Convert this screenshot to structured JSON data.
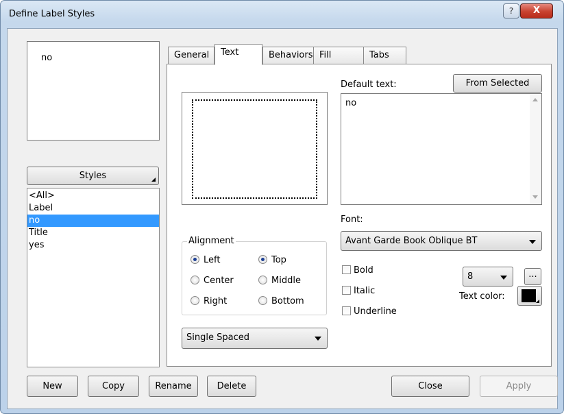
{
  "window": {
    "title": "Define Label Styles",
    "help_label": "?",
    "close_label": "X"
  },
  "preview": {
    "text": "no"
  },
  "styles": {
    "button_label": "Styles",
    "items": [
      "<All>",
      "Label",
      "no",
      "Title",
      "yes"
    ],
    "selected": "no"
  },
  "tabs": [
    {
      "label": "General",
      "active": false
    },
    {
      "label": "Text",
      "active": true
    },
    {
      "label": "Behaviors",
      "active": false
    },
    {
      "label": "Fill",
      "active": false
    },
    {
      "label": "Tabs",
      "active": false
    }
  ],
  "text_tab": {
    "default_text_label": "Default text:",
    "from_selected_label": "From Selected",
    "default_text_value": "no",
    "font_label": "Font:",
    "font_value": "Avant Garde Book Oblique BT",
    "alignment": {
      "title": "Alignment",
      "left": "Left",
      "center": "Center",
      "right": "Right",
      "top": "Top",
      "middle": "Middle",
      "bottom": "Bottom",
      "horizontal_selected": "Left",
      "vertical_selected": "Top"
    },
    "bold_label": "Bold",
    "italic_label": "Italic",
    "underline_label": "Underline",
    "size_value": "8",
    "ellipsis_label": "...",
    "text_color_label": "Text color:",
    "text_color": "#000000",
    "spacing_value": "Single Spaced"
  },
  "buttons": {
    "new": "New",
    "copy": "Copy",
    "rename": "Rename",
    "delete": "Delete",
    "close": "Close",
    "apply": "Apply"
  },
  "colors": {
    "selection": "#3399ff",
    "close_button": "#c8412f"
  }
}
